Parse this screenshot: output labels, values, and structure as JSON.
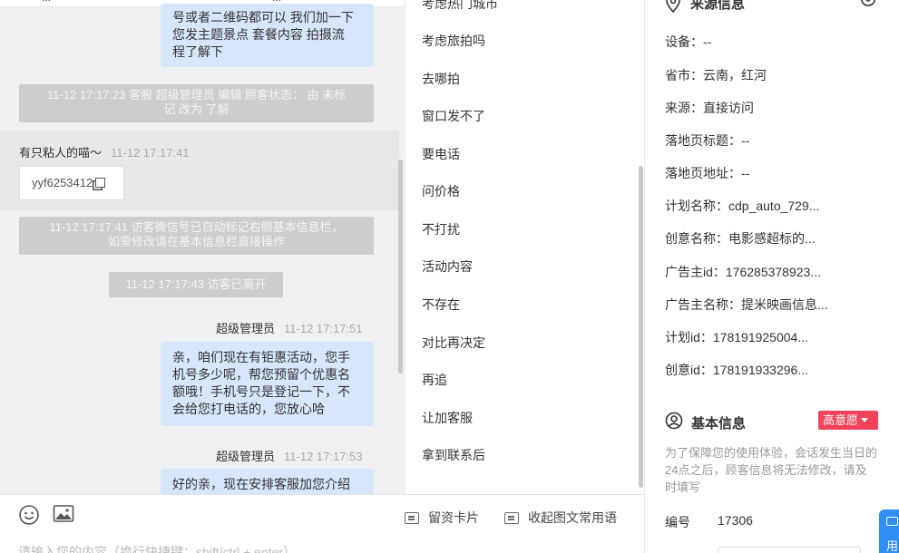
{
  "chat": {
    "top_fragments": [
      "...",
      "..."
    ],
    "messages": [
      {
        "lines": [
          "号或者二维码都可以 我们加一下",
          "您发主题景点 套餐内容 拍摄流",
          "程了解下"
        ]
      },
      {
        "system": [
          "11-12 17:17:23 客服 超级管理员 编辑 顾客状态： 由 未标",
          "记 改为 了解"
        ]
      },
      {
        "visitor": "有只粘人的喵～",
        "time": "11-12 17:17:41",
        "chip": "yyf6253412"
      },
      {
        "system": [
          "11-12 17:17:41 访客微信号已自动标记右侧基本信息栏，",
          "如需修改请在基本信息栏直接操作"
        ]
      },
      {
        "system": [
          "11-12 17:17:43 访客已离开"
        ]
      },
      {
        "agent": "超级管理员",
        "time": "11-12 17:17:51",
        "lines": [
          "亲，咱们现在有钜惠活动，您手",
          "机号多少呢，帮您预留个优惠名",
          "额哦！手机号只是登记一下，不",
          "会给您打电话的，您放心哈"
        ]
      },
      {
        "agent": "超级管理员",
        "time": "11-12 17:17:53",
        "lines": [
          "好的亲，现在安排客服加您介绍"
        ]
      }
    ]
  },
  "composer": {
    "tools": {
      "card": "留资卡片",
      "common": "收起图文常用语"
    },
    "placeholder": "请输入您的内容（换行快捷键：shift/ctrl + enter）"
  },
  "phrases": [
    "考虑热门城市",
    "考虑旅拍吗",
    "去哪拍",
    "窗口发不了",
    "要电话",
    "问价格",
    "不打扰",
    "活动内容",
    "不存在",
    "对比再决定",
    "再追",
    "让加客服",
    "拿到联系后"
  ],
  "source": {
    "title": "来源信息",
    "rows": [
      "设备：--",
      "省市：云南，红河",
      "来源：直接访问",
      "落地页标题：--",
      "落地页地址：--",
      "计划名称：cdp_auto_729...",
      "创意名称：电影感超标的...",
      "广告主id：176285378923...",
      "广告主名称：提米映画信息...",
      "计划id：178191925004...",
      "创意id：178191933296..."
    ]
  },
  "basic": {
    "title": "基本信息",
    "intent": "高意愿",
    "note": "为了保障您的使用体验，会话发生当日的24点之后，顾客信息将无法修改，请及时填写",
    "number_label": "编号",
    "number_value": "17306"
  },
  "float_button": "用",
  "colors": {
    "bubble": "#d7e6fb",
    "system": "#cdcdcd",
    "intent": "#f0425a",
    "float": "#2f8df5"
  },
  "icons": [
    "emoji-icon",
    "image-icon",
    "card-icon",
    "phrase-icon",
    "location-icon",
    "edit-icon",
    "user-icon",
    "caret-down-icon"
  ]
}
